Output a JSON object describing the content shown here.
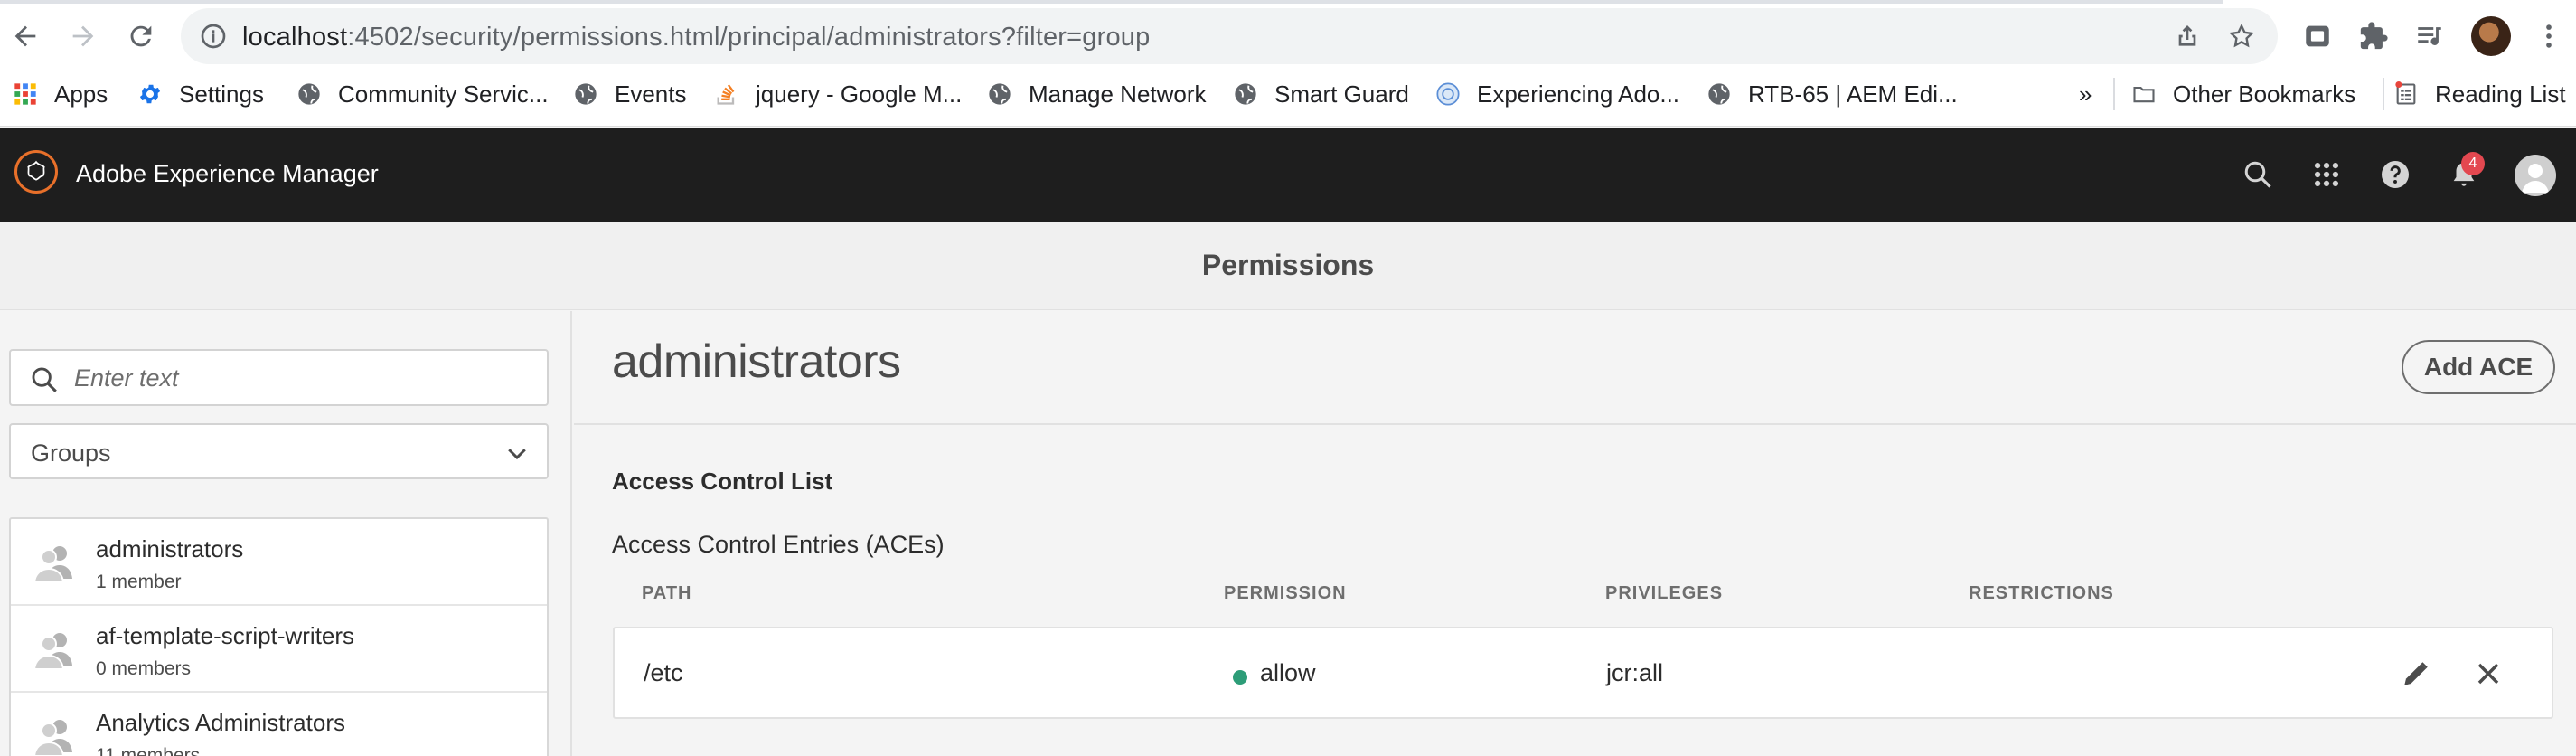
{
  "browser": {
    "url_host": "localhost",
    "url_rest": ":4502/security/permissions.html/principal/administrators?filter=group",
    "bookmarks": [
      {
        "label": "Apps",
        "icon": "apps-grid-icon"
      },
      {
        "label": "Settings",
        "icon": "gear-icon"
      },
      {
        "label": "Community Servic...",
        "icon": "globe-icon"
      },
      {
        "label": "Events",
        "icon": "globe-icon"
      },
      {
        "label": "jquery - Google M...",
        "icon": "stack-overflow-icon"
      },
      {
        "label": "Manage Network",
        "icon": "globe-icon"
      },
      {
        "label": "Smart Guard",
        "icon": "globe-icon"
      },
      {
        "label": "Experiencing Ado...",
        "icon": "adobe-badge-icon"
      },
      {
        "label": "RTB-65 | AEM Edi...",
        "icon": "globe-icon"
      }
    ],
    "overflow_label": "»",
    "other_bookmarks": "Other Bookmarks",
    "reading_list": "Reading List"
  },
  "aem": {
    "app_title": "Adobe Experience Manager",
    "notification_count": "4",
    "accent": "#e8702a"
  },
  "page": {
    "title": "Permissions"
  },
  "rail": {
    "search_placeholder": "Enter text",
    "filter_value": "Groups",
    "items": [
      {
        "name": "administrators",
        "count": "1 member"
      },
      {
        "name": "af-template-script-writers",
        "count": "0 members"
      },
      {
        "name": "Analytics Administrators",
        "count": "11 members"
      }
    ]
  },
  "main": {
    "principal": "administrators",
    "add_button": "Add ACE",
    "acl_heading": "Access Control List",
    "aces_heading": "Access Control Entries (ACEs)",
    "columns": [
      "PATH",
      "PERMISSION",
      "PRIVILEGES",
      "RESTRICTIONS"
    ],
    "rows": [
      {
        "path": "/etc",
        "permission": "allow",
        "privileges": "jcr:all",
        "restrictions": "",
        "permission_color": "#2d9d78"
      }
    ]
  }
}
